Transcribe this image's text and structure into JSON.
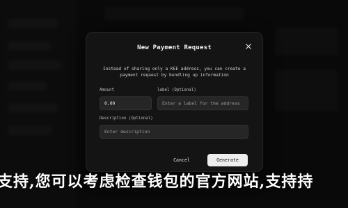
{
  "modal": {
    "title": "New Payment Request",
    "description": "Instead of sharing only a KEE address, you can create a payment request by bundling up information",
    "amount_label": "Amount",
    "amount_value": "0.00",
    "label_label": "label (Optional)",
    "label_placeholder": "Enter a label for the address",
    "description_label": "Description (Optional)",
    "description_placeholder": "Enter description",
    "cancel_label": "Cancel",
    "generate_label": "Generate"
  },
  "banner": {
    "text": "支持,您可以考虑检查钱包的官方网站,支持持"
  },
  "icons": {
    "close": "close-icon"
  },
  "colors": {
    "background": "#0f0f0f",
    "modal": "#141414",
    "field": "#262626",
    "primary_button": "#ededed"
  }
}
